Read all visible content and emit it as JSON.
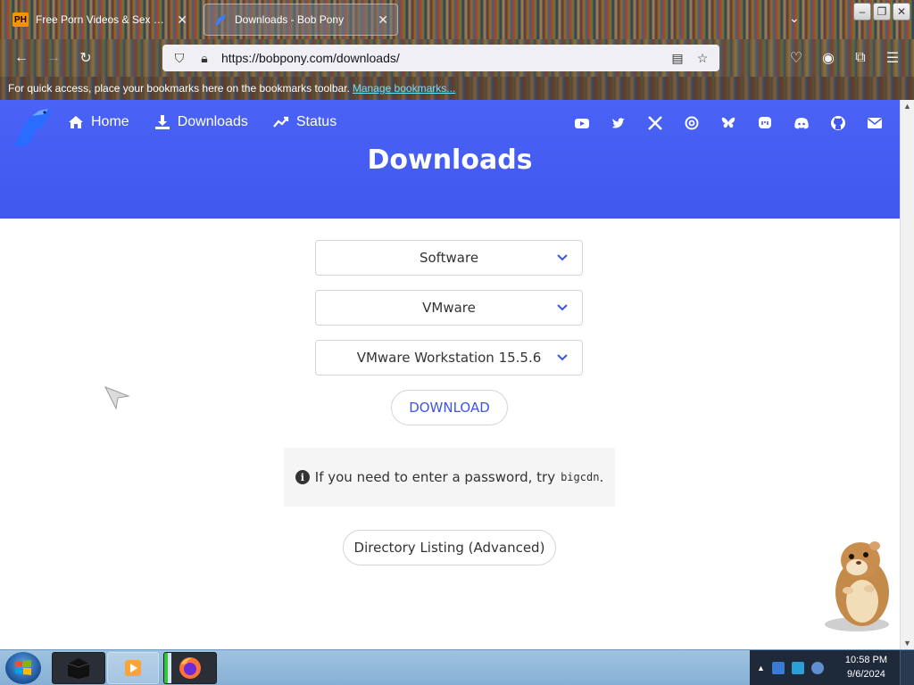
{
  "browser": {
    "tabs": [
      {
        "label": "Free Porn Videos & Sex Movies",
        "favicon": "PH"
      },
      {
        "label": "Downloads - Bob Pony"
      }
    ],
    "url": "https://bobpony.com/downloads/",
    "bookmarks_prompt": "For quick access, place your bookmarks here on the bookmarks toolbar.",
    "manage_bookmarks": "Manage bookmarks..."
  },
  "site": {
    "nav": [
      {
        "label": "Home",
        "icon": "home-icon"
      },
      {
        "label": "Downloads",
        "icon": "download-icon"
      },
      {
        "label": "Status",
        "icon": "trending-up-icon"
      }
    ],
    "socials": [
      "youtube-icon",
      "twitter-icon",
      "x-icon",
      "threads-icon",
      "bluesky-icon",
      "mastodon-icon",
      "discord-icon",
      "github-icon",
      "email-icon"
    ],
    "title": "Downloads",
    "accent": "#4158ef"
  },
  "downloads": {
    "category_select": "Software",
    "vendor_select": "VMware",
    "product_select": "VMware Workstation 15.5.6",
    "download_button": "DOWNLOAD",
    "notice_text": "If you need to enter a password, try",
    "notice_code": "bigcdn",
    "notice_period": ".",
    "directory_button": "Directory Listing (Advanced)"
  },
  "taskbar": {
    "time": "10:58 PM",
    "date": "9/6/2024"
  }
}
